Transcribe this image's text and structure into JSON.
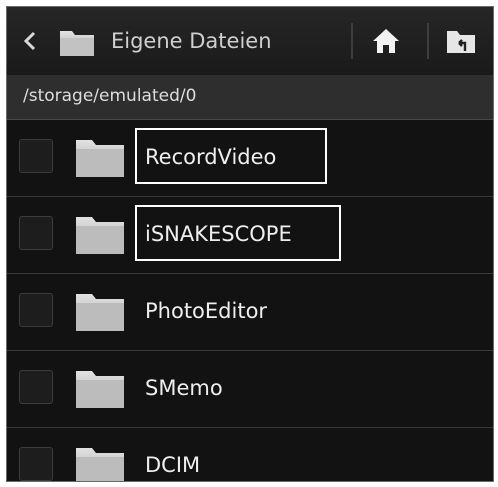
{
  "header": {
    "title": "Eigene Dateien",
    "back_icon": "chevron-left-icon",
    "folder_icon": "folder-icon",
    "home_icon": "home-icon",
    "up_icon": "folder-up-icon"
  },
  "path": "/storage/emulated/0",
  "files": [
    {
      "name": "RecordVideo",
      "highlighted": true
    },
    {
      "name": "iSNAKESCOPE",
      "highlighted": true
    },
    {
      "name": "PhotoEditor",
      "highlighted": false
    },
    {
      "name": "SMemo",
      "highlighted": false
    },
    {
      "name": "DCIM",
      "highlighted": false
    }
  ],
  "colors": {
    "background": "#121212",
    "action_bar": "#222222",
    "path_bar": "#2e2e2e",
    "folder": "#c8c8c8",
    "text": "#eeeeee",
    "highlight": "#ffffff"
  }
}
